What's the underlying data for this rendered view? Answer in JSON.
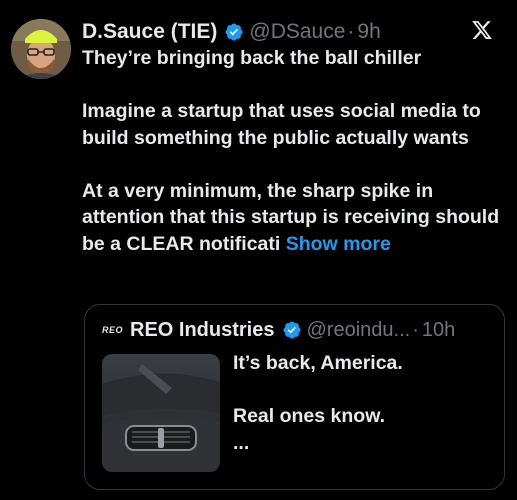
{
  "author": {
    "display_name": "D.Sauce (TIE)",
    "handle": "@DSauce",
    "separator": "·",
    "time": "9h",
    "verified_icon": "verified-badge-icon"
  },
  "tweet": {
    "paragraphs": [
      "They’re bringing back the ball chiller",
      "Imagine a startup that uses social media to build something the public actually wants",
      "At a very minimum, the sharp spike in attention that this startup is receiving should be a CLEAR notificati"
    ],
    "show_more_label": "Show more"
  },
  "quote": {
    "logo_text": "REO",
    "display_name": "REO Industries",
    "handle": "@reoindu...",
    "separator": "·",
    "time": "10h",
    "paragraphs": [
      "It’s back, America.",
      "Real ones know.",
      "..."
    ]
  },
  "colors": {
    "background": "#000000",
    "text": "#e7e9ea",
    "secondary": "#71767b",
    "accent": "#1d9bf0",
    "border": "#333639"
  }
}
